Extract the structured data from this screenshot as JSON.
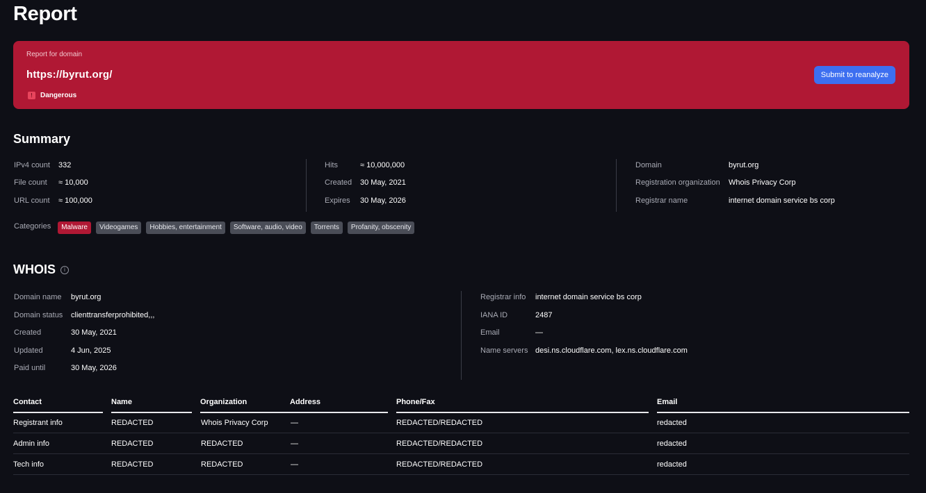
{
  "page": {
    "title": "Report"
  },
  "banner": {
    "caption": "Report for domain",
    "domain": "https://byrut.org/",
    "verdict": "Dangerous",
    "reanalyze_label": "Submit to reanalyze",
    "color": "#b01834",
    "button_color": "#3d6ff0"
  },
  "summary": {
    "title": "Summary",
    "col1": [
      {
        "label": "IPv4 count",
        "value": "332"
      },
      {
        "label": "File count",
        "value": "≈ 10,000"
      },
      {
        "label": "URL count",
        "value": "≈ 100,000"
      }
    ],
    "col2": [
      {
        "label": "Hits",
        "value": "≈ 10,000,000"
      },
      {
        "label": "Created",
        "value": "30 May, 2021"
      },
      {
        "label": "Expires",
        "value": "30 May, 2026"
      }
    ],
    "col3": [
      {
        "label": "Domain",
        "value": "byrut.org"
      },
      {
        "label": "Registration organization",
        "value": "Whois Privacy Corp"
      },
      {
        "label": "Registrar name",
        "value": "internet domain service bs corp"
      }
    ],
    "categories_label": "Categories",
    "categories": [
      {
        "label": "Malware",
        "danger": true
      },
      {
        "label": "Videogames",
        "danger": false
      },
      {
        "label": "Hobbies, entertainment",
        "danger": false
      },
      {
        "label": "Software, audio, video",
        "danger": false
      },
      {
        "label": "Torrents",
        "danger": false
      },
      {
        "label": "Profanity, obscenity",
        "danger": false
      }
    ]
  },
  "whois": {
    "title": "WHOIS",
    "info_icon": "info-icon",
    "left": [
      {
        "label": "Domain name",
        "value": "byrut.org"
      },
      {
        "label": "Domain status",
        "value": "clienttransferprohibited,,,"
      },
      {
        "label": "Created",
        "value": "30 May, 2021"
      },
      {
        "label": "Updated",
        "value": "4 Jun, 2025"
      },
      {
        "label": "Paid until",
        "value": "30 May, 2026"
      }
    ],
    "right": [
      {
        "label": "Registrar info",
        "value": "internet domain service bs corp"
      },
      {
        "label": "IANA ID",
        "value": "2487"
      },
      {
        "label": "Email",
        "value": "—"
      },
      {
        "label": "Name servers",
        "value": "desi.ns.cloudflare.com, lex.ns.cloudflare.com"
      }
    ]
  },
  "contacts": {
    "headers": [
      "Contact",
      "Name",
      "Organization",
      "Address",
      "Phone/Fax",
      "Email"
    ],
    "rows": [
      [
        "Registrant info",
        "REDACTED",
        "Whois Privacy Corp",
        "—",
        "REDACTED/REDACTED",
        "redacted"
      ],
      [
        "Admin info",
        "REDACTED",
        "REDACTED",
        "—",
        "REDACTED/REDACTED",
        "redacted"
      ],
      [
        "Tech info",
        "REDACTED",
        "REDACTED",
        "—",
        "REDACTED/REDACTED",
        "redacted"
      ]
    ]
  }
}
